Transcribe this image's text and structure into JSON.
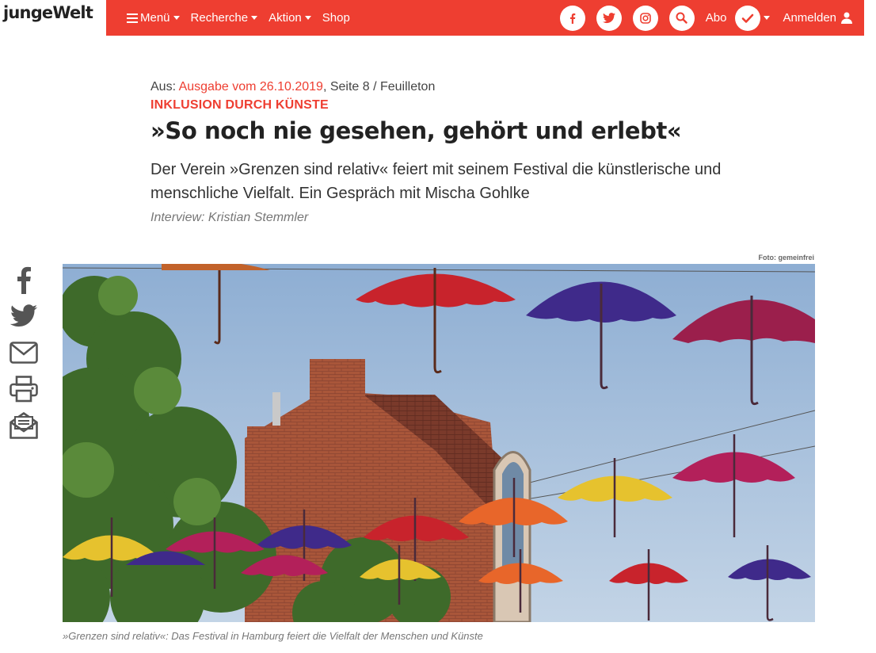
{
  "logo": {
    "part1": "junge",
    "part2": "Welt"
  },
  "nav": {
    "menu": "Menü",
    "research": "Recherche",
    "action": "Aktion",
    "shop": "Shop",
    "abo": "Abo",
    "login": "Anmelden",
    "icons": [
      "facebook-icon",
      "twitter-icon",
      "instagram-icon",
      "search-icon",
      "check-icon",
      "user-icon"
    ]
  },
  "article": {
    "meta_prefix": "Aus: ",
    "issue_link": "Ausgabe vom 26.10.2019",
    "meta_suffix": ", Seite 8 / Feuilleton",
    "kicker": "INKLUSION DURCH KÜNSTE",
    "title": "»So noch nie gesehen, gehört und erlebt«",
    "teaser": "Der Verein »Grenzen sind relativ« feiert mit seinem Festival die künstlerische und menschliche Vielfalt. Ein Gespräch mit Mischa Gohlke",
    "author": "Interview: Kristian Stemmler"
  },
  "share": [
    "facebook-icon",
    "twitter-icon",
    "mail-icon",
    "print-icon",
    "newsletter-icon"
  ],
  "image": {
    "credit": "Foto: gemeinfrei",
    "caption": "»Grenzen sind relativ«: Das Festival in Hamburg feiert die Vielfalt der Menschen und Künste"
  },
  "colors": {
    "brand": "#ee3e31",
    "sky": "#a9c3df",
    "brick": "#a9563a"
  }
}
